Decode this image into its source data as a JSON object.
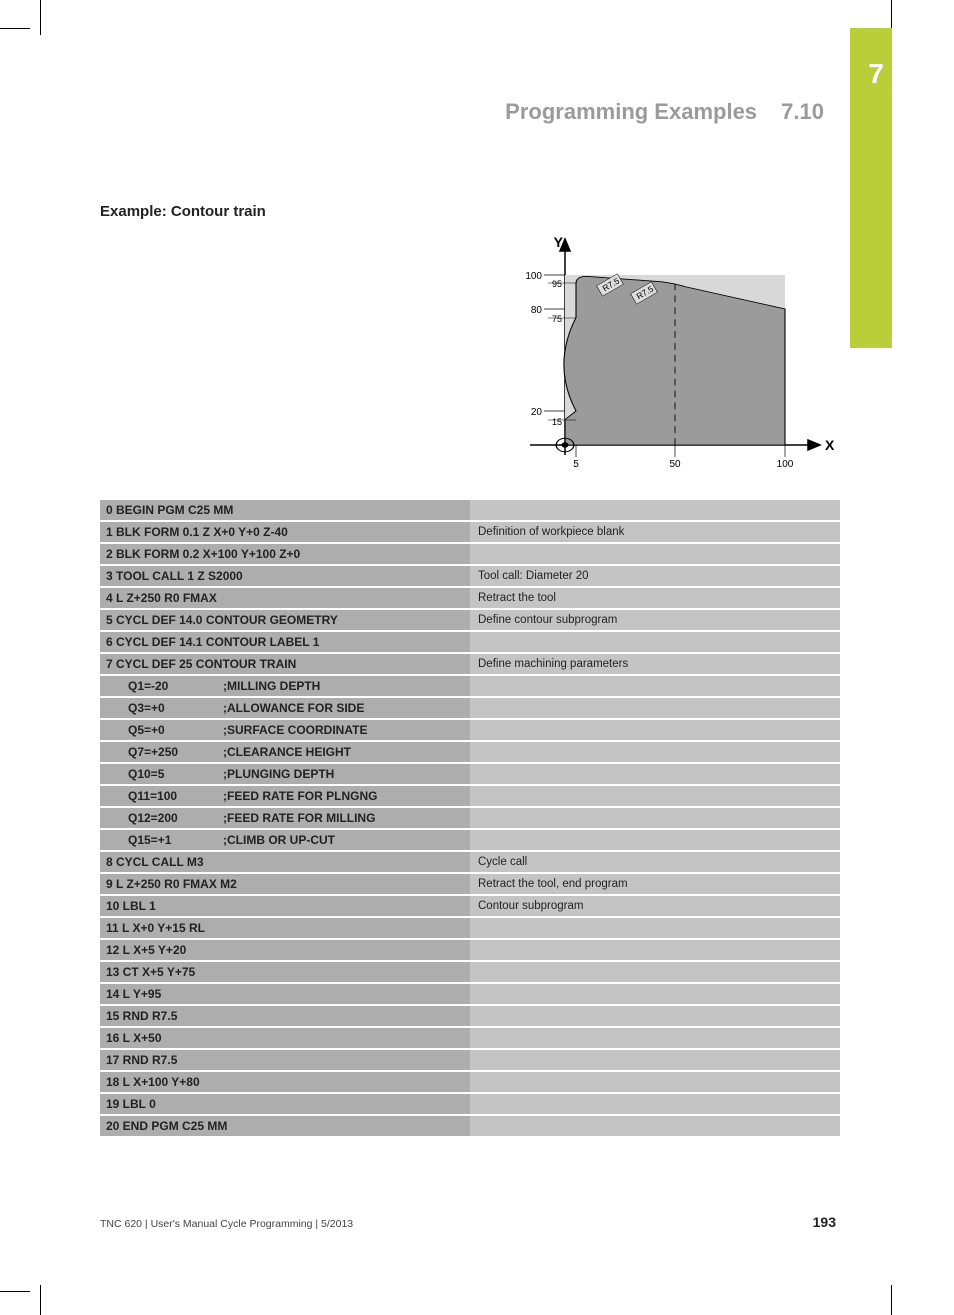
{
  "chapter": "7",
  "header": {
    "title": "Programming Examples",
    "section": "7.10"
  },
  "example_title": "Example: Contour train",
  "figure": {
    "y_label": "Y",
    "x_label": "X",
    "y_ticks_outer": [
      "100",
      "80",
      "20"
    ],
    "y_ticks_inner": [
      "95",
      "75",
      "15"
    ],
    "x_ticks": [
      "5",
      "50",
      "100"
    ],
    "radii": [
      "R7.5",
      "R7.5"
    ]
  },
  "rows": [
    {
      "code": "0 BEGIN PGM C25 MM",
      "desc": ""
    },
    {
      "code": "1 BLK FORM 0.1 Z X+0 Y+0 Z-40",
      "desc": "Definition of workpiece blank"
    },
    {
      "code": "2 BLK FORM 0.2 X+100 Y+100 Z+0",
      "desc": ""
    },
    {
      "code": "3 TOOL CALL 1 Z S2000",
      "desc": "Tool call: Diameter 20"
    },
    {
      "code": "4 L Z+250 R0 FMAX",
      "desc": "Retract the tool"
    },
    {
      "code": "5 CYCL DEF 14.0 CONTOUR GEOMETRY",
      "desc": "Define contour subprogram"
    },
    {
      "code": "6 CYCL DEF 14.1 CONTOUR LABEL 1",
      "desc": ""
    },
    {
      "code": "7 CYCL DEF 25 CONTOUR TRAIN",
      "desc": "Define machining parameters"
    },
    {
      "indent": true,
      "q": "Q1=-20",
      "label": ";MILLING DEPTH",
      "desc": ""
    },
    {
      "indent": true,
      "q": "Q3=+0",
      "label": ";ALLOWANCE FOR SIDE",
      "desc": ""
    },
    {
      "indent": true,
      "q": "Q5=+0",
      "label": ";SURFACE COORDINATE",
      "desc": ""
    },
    {
      "indent": true,
      "q": "Q7=+250",
      "label": ";CLEARANCE HEIGHT",
      "desc": ""
    },
    {
      "indent": true,
      "q": "Q10=5",
      "label": ";PLUNGING DEPTH",
      "desc": ""
    },
    {
      "indent": true,
      "q": "Q11=100",
      "label": ";FEED RATE FOR PLNGNG",
      "desc": ""
    },
    {
      "indent": true,
      "q": "Q12=200",
      "label": ";FEED RATE FOR MILLING",
      "desc": ""
    },
    {
      "indent": true,
      "q": "Q15=+1",
      "label": ";CLIMB OR UP-CUT",
      "desc": ""
    },
    {
      "code": "8 CYCL CALL M3",
      "desc": "Cycle call"
    },
    {
      "code": "9 L Z+250 R0 FMAX M2",
      "desc": "Retract the tool, end program"
    },
    {
      "code": "10 LBL 1",
      "desc": "Contour subprogram"
    },
    {
      "code": "11 L X+0 Y+15 RL",
      "desc": ""
    },
    {
      "code": "12 L X+5 Y+20",
      "desc": ""
    },
    {
      "code": "13 CT X+5 Y+75",
      "desc": ""
    },
    {
      "code": "14 L Y+95",
      "desc": ""
    },
    {
      "code": "15 RND R7.5",
      "desc": ""
    },
    {
      "code": "16 L X+50",
      "desc": ""
    },
    {
      "code": "17 RND R7.5",
      "desc": ""
    },
    {
      "code": "18 L X+100 Y+80",
      "desc": ""
    },
    {
      "code": "19 LBL 0",
      "desc": ""
    },
    {
      "code": "20 END PGM C25 MM",
      "desc": ""
    }
  ],
  "footer": {
    "left": "TNC 620 | User's Manual Cycle Programming | 5/2013",
    "page": "193"
  }
}
